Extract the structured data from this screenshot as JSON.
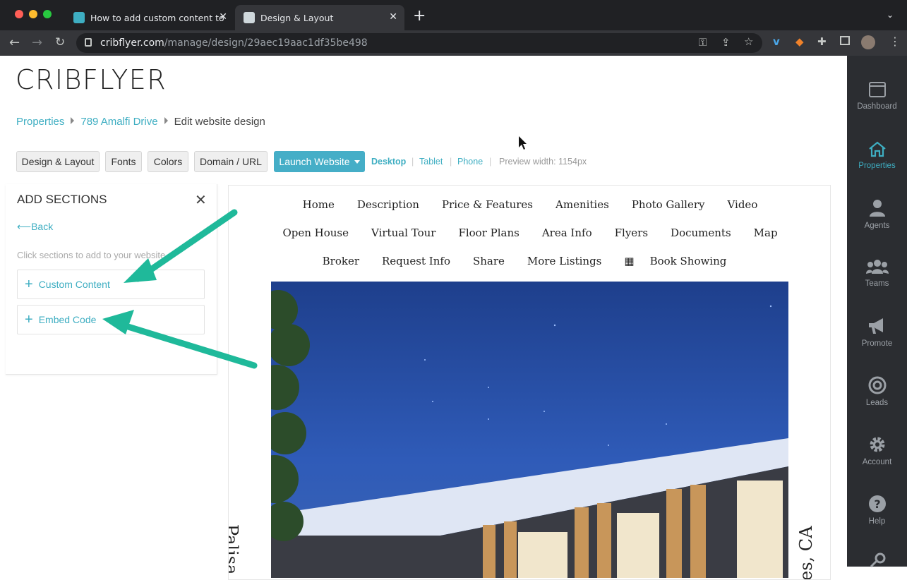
{
  "browser": {
    "tabs": [
      {
        "title": "How to add custom content to"
      },
      {
        "title": "Design & Layout"
      }
    ],
    "url_host": "cribflyer.com",
    "url_path": "/manage/design/29aec19aac1df35be498"
  },
  "app": {
    "logo": "CRIBFLYER",
    "breadcrumb": {
      "properties": "Properties",
      "property": "789 Amalfi Drive",
      "current": "Edit website design"
    },
    "toolbar": {
      "design_layout": "Design & Layout",
      "fonts": "Fonts",
      "colors": "Colors",
      "domain": "Domain / URL",
      "launch": "Launch Website",
      "desktop": "Desktop",
      "tablet": "Tablet",
      "phone": "Phone",
      "preview_width": "Preview width: 1154px"
    },
    "add_sections": {
      "title": "ADD SECTIONS",
      "back": "Back",
      "hint": "Click sections to add to your website.",
      "items": [
        "Custom Content",
        "Embed Code"
      ]
    }
  },
  "preview": {
    "nav_rows": [
      [
        "Home",
        "Description",
        "Price & Features",
        "Amenities",
        "Photo Gallery",
        "Video"
      ],
      [
        "Open House",
        "Virtual Tour",
        "Floor Plans",
        "Area Info",
        "Flyers",
        "Documents",
        "Map"
      ],
      [
        "Broker",
        "Request Info",
        "Share",
        "More Listings",
        "Book Showing"
      ]
    ],
    "left_vertical": "Palisa",
    "right_vertical": "es, CA"
  },
  "rail": {
    "items": [
      {
        "label": "Dashboard",
        "icon": "window-icon",
        "active": false
      },
      {
        "label": "Properties",
        "icon": "home-icon",
        "active": true
      },
      {
        "label": "Agents",
        "icon": "user-icon",
        "active": false
      },
      {
        "label": "Teams",
        "icon": "users-icon",
        "active": false
      },
      {
        "label": "Promote",
        "icon": "megaphone-icon",
        "active": false
      },
      {
        "label": "Leads",
        "icon": "target-icon",
        "active": false
      },
      {
        "label": "Account",
        "icon": "gear-icon",
        "active": false
      },
      {
        "label": "Help",
        "icon": "question-icon",
        "active": false
      }
    ]
  },
  "colors": {
    "accent": "#3eaec2",
    "launch": "#45aec7",
    "rail": "#2b2d31",
    "arrow": "#1fb99a"
  }
}
